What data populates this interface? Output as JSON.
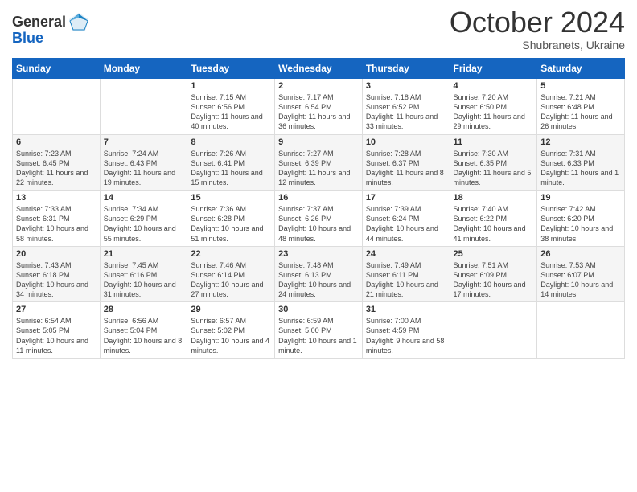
{
  "logo": {
    "line1": "General",
    "line2": "Blue"
  },
  "title": "October 2024",
  "subtitle": "Shubranets, Ukraine",
  "days_header": [
    "Sunday",
    "Monday",
    "Tuesday",
    "Wednesday",
    "Thursday",
    "Friday",
    "Saturday"
  ],
  "weeks": [
    [
      {
        "day": "",
        "info": ""
      },
      {
        "day": "",
        "info": ""
      },
      {
        "day": "1",
        "info": "Sunrise: 7:15 AM\nSunset: 6:56 PM\nDaylight: 11 hours and 40 minutes."
      },
      {
        "day": "2",
        "info": "Sunrise: 7:17 AM\nSunset: 6:54 PM\nDaylight: 11 hours and 36 minutes."
      },
      {
        "day": "3",
        "info": "Sunrise: 7:18 AM\nSunset: 6:52 PM\nDaylight: 11 hours and 33 minutes."
      },
      {
        "day": "4",
        "info": "Sunrise: 7:20 AM\nSunset: 6:50 PM\nDaylight: 11 hours and 29 minutes."
      },
      {
        "day": "5",
        "info": "Sunrise: 7:21 AM\nSunset: 6:48 PM\nDaylight: 11 hours and 26 minutes."
      }
    ],
    [
      {
        "day": "6",
        "info": "Sunrise: 7:23 AM\nSunset: 6:45 PM\nDaylight: 11 hours and 22 minutes."
      },
      {
        "day": "7",
        "info": "Sunrise: 7:24 AM\nSunset: 6:43 PM\nDaylight: 11 hours and 19 minutes."
      },
      {
        "day": "8",
        "info": "Sunrise: 7:26 AM\nSunset: 6:41 PM\nDaylight: 11 hours and 15 minutes."
      },
      {
        "day": "9",
        "info": "Sunrise: 7:27 AM\nSunset: 6:39 PM\nDaylight: 11 hours and 12 minutes."
      },
      {
        "day": "10",
        "info": "Sunrise: 7:28 AM\nSunset: 6:37 PM\nDaylight: 11 hours and 8 minutes."
      },
      {
        "day": "11",
        "info": "Sunrise: 7:30 AM\nSunset: 6:35 PM\nDaylight: 11 hours and 5 minutes."
      },
      {
        "day": "12",
        "info": "Sunrise: 7:31 AM\nSunset: 6:33 PM\nDaylight: 11 hours and 1 minute."
      }
    ],
    [
      {
        "day": "13",
        "info": "Sunrise: 7:33 AM\nSunset: 6:31 PM\nDaylight: 10 hours and 58 minutes."
      },
      {
        "day": "14",
        "info": "Sunrise: 7:34 AM\nSunset: 6:29 PM\nDaylight: 10 hours and 55 minutes."
      },
      {
        "day": "15",
        "info": "Sunrise: 7:36 AM\nSunset: 6:28 PM\nDaylight: 10 hours and 51 minutes."
      },
      {
        "day": "16",
        "info": "Sunrise: 7:37 AM\nSunset: 6:26 PM\nDaylight: 10 hours and 48 minutes."
      },
      {
        "day": "17",
        "info": "Sunrise: 7:39 AM\nSunset: 6:24 PM\nDaylight: 10 hours and 44 minutes."
      },
      {
        "day": "18",
        "info": "Sunrise: 7:40 AM\nSunset: 6:22 PM\nDaylight: 10 hours and 41 minutes."
      },
      {
        "day": "19",
        "info": "Sunrise: 7:42 AM\nSunset: 6:20 PM\nDaylight: 10 hours and 38 minutes."
      }
    ],
    [
      {
        "day": "20",
        "info": "Sunrise: 7:43 AM\nSunset: 6:18 PM\nDaylight: 10 hours and 34 minutes."
      },
      {
        "day": "21",
        "info": "Sunrise: 7:45 AM\nSunset: 6:16 PM\nDaylight: 10 hours and 31 minutes."
      },
      {
        "day": "22",
        "info": "Sunrise: 7:46 AM\nSunset: 6:14 PM\nDaylight: 10 hours and 27 minutes."
      },
      {
        "day": "23",
        "info": "Sunrise: 7:48 AM\nSunset: 6:13 PM\nDaylight: 10 hours and 24 minutes."
      },
      {
        "day": "24",
        "info": "Sunrise: 7:49 AM\nSunset: 6:11 PM\nDaylight: 10 hours and 21 minutes."
      },
      {
        "day": "25",
        "info": "Sunrise: 7:51 AM\nSunset: 6:09 PM\nDaylight: 10 hours and 17 minutes."
      },
      {
        "day": "26",
        "info": "Sunrise: 7:53 AM\nSunset: 6:07 PM\nDaylight: 10 hours and 14 minutes."
      }
    ],
    [
      {
        "day": "27",
        "info": "Sunrise: 6:54 AM\nSunset: 5:05 PM\nDaylight: 10 hours and 11 minutes."
      },
      {
        "day": "28",
        "info": "Sunrise: 6:56 AM\nSunset: 5:04 PM\nDaylight: 10 hours and 8 minutes."
      },
      {
        "day": "29",
        "info": "Sunrise: 6:57 AM\nSunset: 5:02 PM\nDaylight: 10 hours and 4 minutes."
      },
      {
        "day": "30",
        "info": "Sunrise: 6:59 AM\nSunset: 5:00 PM\nDaylight: 10 hours and 1 minute."
      },
      {
        "day": "31",
        "info": "Sunrise: 7:00 AM\nSunset: 4:59 PM\nDaylight: 9 hours and 58 minutes."
      },
      {
        "day": "",
        "info": ""
      },
      {
        "day": "",
        "info": ""
      }
    ]
  ]
}
